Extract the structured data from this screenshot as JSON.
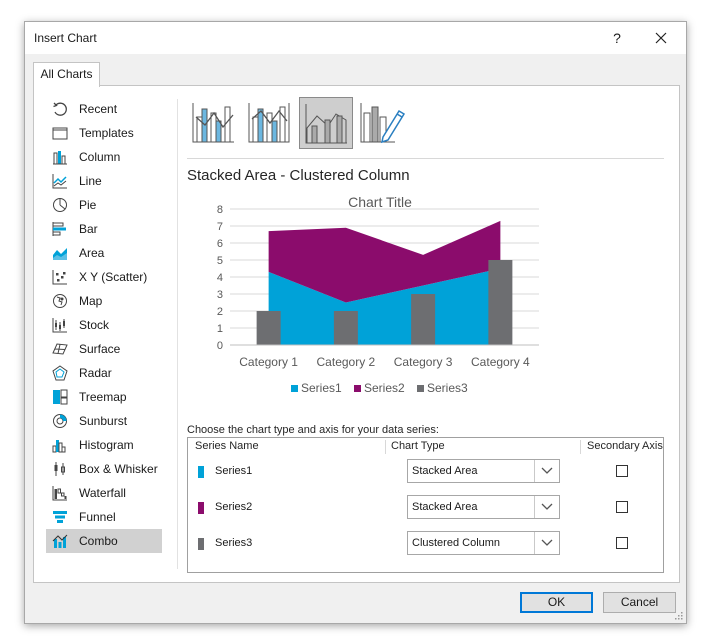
{
  "window": {
    "title": "Insert Chart",
    "help": "?",
    "close": "✕"
  },
  "tabs": [
    {
      "label": "All Charts"
    }
  ],
  "sidebar": {
    "items": [
      {
        "label": "Recent",
        "icon": "recent-icon"
      },
      {
        "label": "Templates",
        "icon": "templates-icon"
      },
      {
        "label": "Column",
        "icon": "column-chart-icon"
      },
      {
        "label": "Line",
        "icon": "line-chart-icon"
      },
      {
        "label": "Pie",
        "icon": "pie-chart-icon"
      },
      {
        "label": "Bar",
        "icon": "bar-chart-icon"
      },
      {
        "label": "Area",
        "icon": "area-chart-icon"
      },
      {
        "label": "X Y (Scatter)",
        "icon": "scatter-chart-icon"
      },
      {
        "label": "Map",
        "icon": "map-chart-icon"
      },
      {
        "label": "Stock",
        "icon": "stock-chart-icon"
      },
      {
        "label": "Surface",
        "icon": "surface-chart-icon"
      },
      {
        "label": "Radar",
        "icon": "radar-chart-icon"
      },
      {
        "label": "Treemap",
        "icon": "treemap-chart-icon"
      },
      {
        "label": "Sunburst",
        "icon": "sunburst-chart-icon"
      },
      {
        "label": "Histogram",
        "icon": "histogram-chart-icon"
      },
      {
        "label": "Box & Whisker",
        "icon": "box-whisker-chart-icon"
      },
      {
        "label": "Waterfall",
        "icon": "waterfall-chart-icon"
      },
      {
        "label": "Funnel",
        "icon": "funnel-chart-icon"
      },
      {
        "label": "Combo",
        "icon": "combo-chart-icon",
        "selected": true
      }
    ]
  },
  "subtypes": [
    {
      "icon": "clustered-column-line-icon"
    },
    {
      "icon": "clustered-column-line-secondary-axis-icon"
    },
    {
      "icon": "stacked-area-clustered-column-icon",
      "selected": true
    },
    {
      "icon": "custom-combination-icon"
    }
  ],
  "main": {
    "combo_title": "Stacked Area - Clustered Column"
  },
  "colors": {
    "series1": "#00a2d8",
    "series2": "#8b0c6c",
    "series3": "#6d6e71",
    "selected_item": "#d1d1d1",
    "ok_border": "#0078d7"
  },
  "chart_data": {
    "type": "combo",
    "title": "Chart Title",
    "categories": [
      "Category 1",
      "Category 2",
      "Category 3",
      "Category 4"
    ],
    "series": [
      {
        "name": "Series1",
        "chart_type": "stacked-area",
        "values": [
          4.3,
          2.5,
          3.5,
          4.5
        ]
      },
      {
        "name": "Series2",
        "chart_type": "stacked-area",
        "values": [
          2.4,
          4.4,
          1.8,
          2.8
        ]
      },
      {
        "name": "Series3",
        "chart_type": "clustered-column",
        "values": [
          2,
          2,
          3,
          5
        ]
      }
    ],
    "y_ticks": [
      "0",
      "1",
      "2",
      "3",
      "4",
      "5",
      "6",
      "7",
      "8"
    ],
    "ylim": [
      0,
      8
    ],
    "grid": true,
    "legend_position": "bottom"
  },
  "series_table": {
    "caption": "Choose the chart type and axis for your data series:",
    "headers": {
      "name": "Series Name",
      "type": "Chart Type",
      "axis": "Secondary Axis"
    },
    "rows": [
      {
        "name": "Series1",
        "type": "Stacked Area",
        "secondary": false
      },
      {
        "name": "Series2",
        "type": "Stacked Area",
        "secondary": false
      },
      {
        "name": "Series3",
        "type": "Clustered Column",
        "secondary": false
      }
    ]
  },
  "buttons": {
    "ok": "OK",
    "cancel": "Cancel"
  }
}
